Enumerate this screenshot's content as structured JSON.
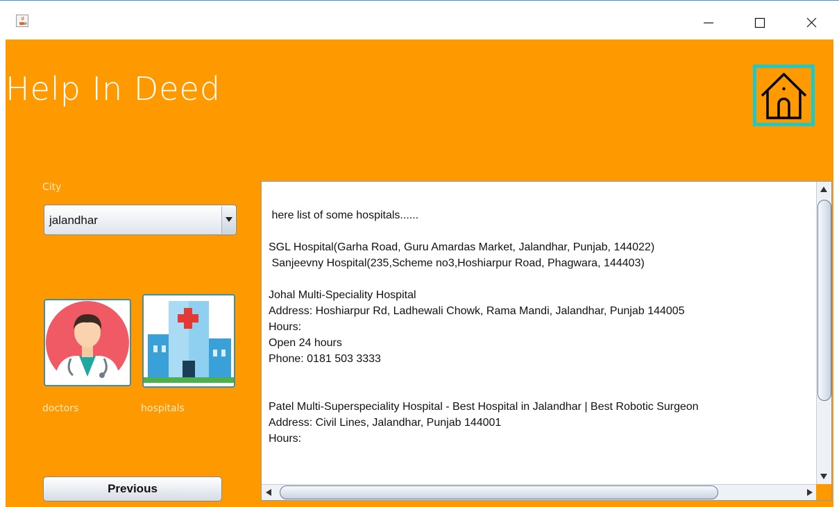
{
  "window": {
    "app_icon": "java-coffee-icon",
    "controls": [
      "minimize-icon",
      "maximize-icon",
      "close-icon"
    ]
  },
  "header": {
    "title": "Help In Deed",
    "home_icon": "home-icon"
  },
  "city": {
    "label": "City",
    "selected": "jalandhar"
  },
  "categories": [
    {
      "label": "doctors",
      "icon": "doctor-icon"
    },
    {
      "label": "hospitals",
      "icon": "hospital-building-icon"
    }
  ],
  "previous_label": "Previous",
  "results": {
    "text": " here list of some hospitals......\n\nSGL Hospital(Garha Road, Guru Amardas Market, Jalandhar, Punjab, 144022)\n Sanjeevny Hospital(235,Scheme no3,Hoshiarpur Road, Phagwara, 144403)\n\nJohal Multi-Speciality Hospital\nAddress: Hoshiarpur Rd, Ladhewali Chowk, Rama Mandi, Jalandhar, Punjab 144005\nHours:\nOpen 24 hours\nPhone: 0181 503 3333\n\n\nPatel Multi-Superspeciality Hospital - Best Hospital in Jalandhar | Best Robotic Surgeon\nAddress: Civil Lines, Jalandhar, Punjab 144001\nHours:"
  },
  "colors": {
    "background": "#ff9900",
    "home_border": "#1fc8c8",
    "text_light": "#ffffff"
  }
}
